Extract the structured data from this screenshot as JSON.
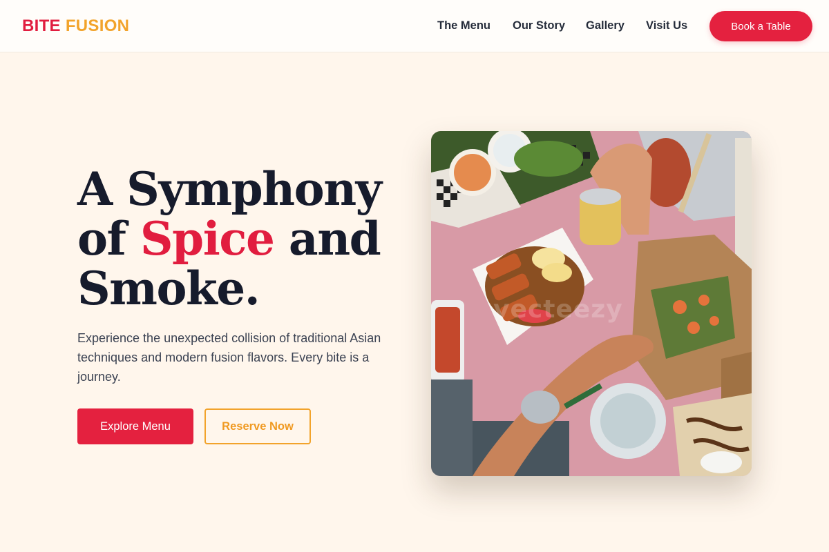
{
  "brand": {
    "word1": "BITE",
    "word2": "FUSION"
  },
  "nav": {
    "items": [
      "The Menu",
      "Our Story",
      "Gallery",
      "Visit Us"
    ],
    "cta_label": "Book a Table"
  },
  "hero": {
    "title_part1": "A Symphony of ",
    "title_accent": "Spice",
    "title_part2": " and Smoke.",
    "subtitle": "Experience the unexpected collision of traditional Asian techniques and modern fusion flavors. Every bite is a journey.",
    "primary_label": "Explore Menu",
    "secondary_label": "Reserve Now"
  },
  "image": {
    "subject": "overhead-food-spread",
    "watermark": "vecteezy"
  },
  "colors": {
    "accent_red": "#e4213f",
    "accent_orange": "#f2a32b",
    "background": "#fff6ec",
    "text_dark": "#161b2c"
  }
}
